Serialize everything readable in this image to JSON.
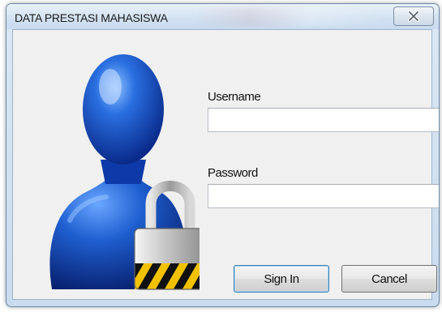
{
  "window": {
    "title": "DATA PRESTASI MAHASISWA",
    "close_icon": "close-x-icon"
  },
  "illustration": {
    "icon": "user-with-padlock-icon"
  },
  "form": {
    "username_label": "Username",
    "username_value": "",
    "password_label": "Password",
    "password_value": ""
  },
  "buttons": {
    "sign_in_label": "Sign In",
    "cancel_label": "Cancel"
  },
  "colors": {
    "accent": "#3c7fb1",
    "user_figure": "#1f5fd0",
    "lock_body": "#c9c9c9",
    "lock_stripes": "#f2c200"
  }
}
